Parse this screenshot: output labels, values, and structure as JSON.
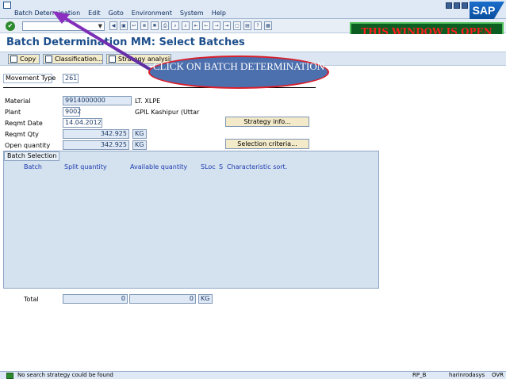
{
  "menu": [
    "Batch Determination",
    "Edit",
    "Goto",
    "Environment",
    "System",
    "Help"
  ],
  "sap_logo": "SAP",
  "banner": "THIS WINDOW IS OPEN",
  "callout": "CLICK ON BATCH DETERMINATION",
  "title": "Batch Determination MM: Select Batches",
  "app_buttons": {
    "copy": "Copy",
    "classification": "Classification...",
    "strategy_analysis": "Strategy analysis"
  },
  "movement_type": {
    "label": "Movement Type",
    "value": "261"
  },
  "fields": {
    "material": {
      "label": "Material",
      "value": "9914000000",
      "desc": "LT. XLPE"
    },
    "plant": {
      "label": "Plant",
      "value": "9002",
      "desc": "GPIL Kashipur (Uttar"
    },
    "reqmt_date": {
      "label": "Reqmt Date",
      "value": "14.04.2012"
    },
    "reqmt_qty": {
      "label": "Reqmt Qty",
      "value": "342.925",
      "unit": "KG"
    },
    "open_qty": {
      "label": "Open quantity",
      "value": "342.925",
      "unit": "KG"
    }
  },
  "buttons": {
    "strategy_info": "Strategy info...",
    "selection_criteria": "Selection criteria..."
  },
  "grid": {
    "title": "Batch Selection",
    "columns": [
      "Batch",
      "Split quantity",
      "Available quantity",
      "SLoc",
      "S",
      "Characteristic sort."
    ]
  },
  "total": {
    "label": "Total",
    "split": "0",
    "available": "0",
    "unit": "KG"
  },
  "status": {
    "message": "No search strategy could be found",
    "sys": "RP_B",
    "user": "harinrodasys",
    "mode": "OVR"
  }
}
